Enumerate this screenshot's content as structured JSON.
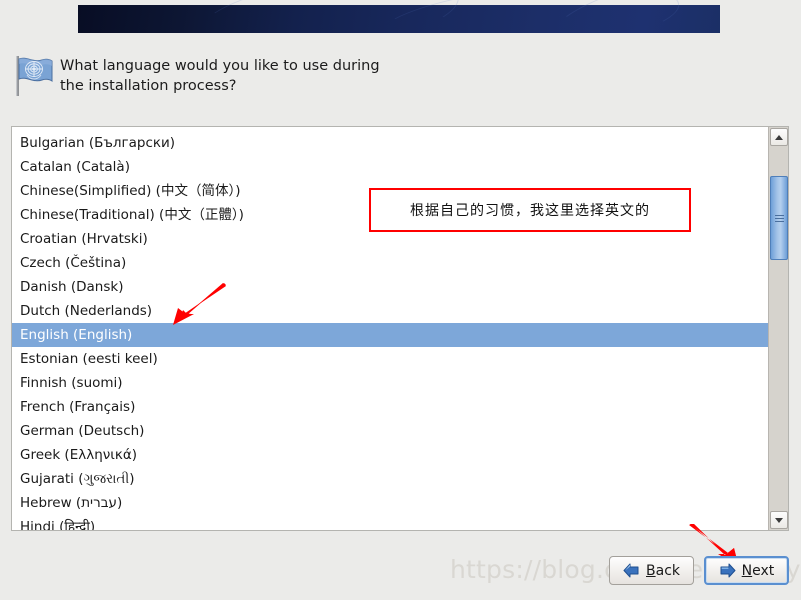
{
  "banner": {
    "name": "installer-banner"
  },
  "header": {
    "icon": "un-flag-icon",
    "question": "What language would you like to use during the installation process?"
  },
  "language_list": {
    "items": [
      {
        "label": "Bulgarian (Български)",
        "selected": false
      },
      {
        "label": "Catalan (Català)",
        "selected": false
      },
      {
        "label": "Chinese(Simplified) (中文（简体）)",
        "selected": false
      },
      {
        "label": "Chinese(Traditional) (中文（正體）)",
        "selected": false
      },
      {
        "label": "Croatian (Hrvatski)",
        "selected": false
      },
      {
        "label": "Czech (Čeština)",
        "selected": false
      },
      {
        "label": "Danish (Dansk)",
        "selected": false
      },
      {
        "label": "Dutch (Nederlands)",
        "selected": false
      },
      {
        "label": "English (English)",
        "selected": true
      },
      {
        "label": "Estonian (eesti keel)",
        "selected": false
      },
      {
        "label": "Finnish (suomi)",
        "selected": false
      },
      {
        "label": "French (Français)",
        "selected": false
      },
      {
        "label": "German (Deutsch)",
        "selected": false
      },
      {
        "label": "Greek (Ελληνικά)",
        "selected": false
      },
      {
        "label": "Gujarati (ગુજરાતી)",
        "selected": false
      },
      {
        "label": "Hebrew (עברית)",
        "selected": false
      },
      {
        "label": "Hindi (हिन्दी)",
        "selected": false
      }
    ],
    "selected_value": "English (English)"
  },
  "scrollbar": {
    "up_icon": "chevron-up-icon",
    "down_icon": "chevron-down-icon",
    "thumb": "scrollbar-thumb"
  },
  "annotation": {
    "note_text": "根据自己的习惯，我这里选择英文的",
    "border_color": "#ff0000",
    "arrow_color": "#ff0000",
    "arrow_to_selection": "arrow-pointing-to-english-row",
    "arrow_to_next": "arrow-pointing-to-next-button"
  },
  "watermark": {
    "text": "https://blog.csdn.net/Daycym"
  },
  "buttons": {
    "back": {
      "label_before": "",
      "label_accel": "B",
      "label_after": "ack",
      "icon": "arrow-left-icon"
    },
    "next": {
      "label_before": "",
      "label_accel": "N",
      "label_after": "ext",
      "icon": "arrow-right-icon",
      "focused": true
    }
  },
  "colors": {
    "page_background": "#ebebe9",
    "banner_dark": "#080d24",
    "banner_light": "#1e3170",
    "selection_blue": "#7da7d9",
    "accent_red": "#ff0000",
    "button_blue_arrow": "#2a5fa8"
  }
}
